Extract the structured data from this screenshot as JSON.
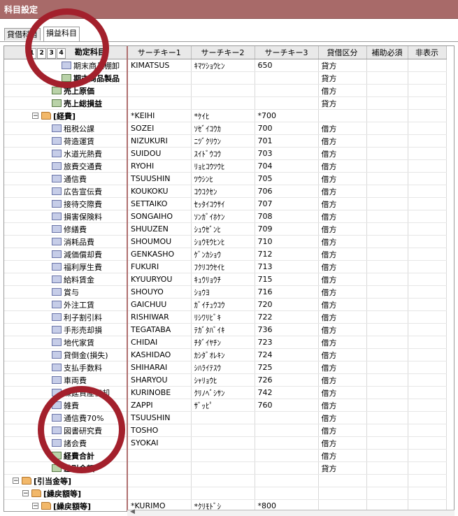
{
  "window": {
    "title": "科目設定"
  },
  "tabs": [
    {
      "label": "貸借科目",
      "active": false
    },
    {
      "label": "損益科目",
      "active": true
    }
  ],
  "grid": {
    "level_buttons": [
      "1",
      "2",
      "3",
      "4"
    ],
    "columns": [
      "勘定科目",
      "サーチキー1",
      "サーチキー2",
      "サーチキー3",
      "貸借区分",
      "補助必須",
      "非表示"
    ],
    "rows": [
      {
        "indent": 5,
        "icon": "doc",
        "name": "期末商品棚卸",
        "bold": false,
        "k1": "KIMATSUS",
        "k2": "ｷﾏﾂｼｮｳﾋﾝ",
        "k3": "650",
        "side": "貸方"
      },
      {
        "indent": 5,
        "icon": "sum",
        "name": "期末商品製品",
        "bold": true,
        "k1": "",
        "k2": "",
        "k3": "",
        "side": "貸方"
      },
      {
        "indent": 4,
        "icon": "sum",
        "name": "売上原価",
        "bold": true,
        "k1": "",
        "k2": "",
        "k3": "",
        "side": "借方"
      },
      {
        "indent": 4,
        "icon": "sum",
        "name": "売上総損益",
        "bold": true,
        "k1": "",
        "k2": "",
        "k3": "",
        "side": "貸方"
      },
      {
        "indent": 2,
        "icon": "folder",
        "expander": "minus",
        "name": "[経費]",
        "bold": true,
        "k1": "*KEIHI",
        "k2": "*ｹｲﾋ",
        "k3": "*700",
        "side": ""
      },
      {
        "indent": 4,
        "icon": "doc",
        "name": "租税公課",
        "k1": "SOZEI",
        "k2": "ｿｾﾞｲｺｳｶ",
        "k3": "700",
        "side": "借方"
      },
      {
        "indent": 4,
        "icon": "doc",
        "name": "荷造運賃",
        "k1": "NIZUKURI",
        "k2": "ﾆﾂﾞｸﾘｳﾝ",
        "k3": "701",
        "side": "借方"
      },
      {
        "indent": 4,
        "icon": "doc",
        "name": "水道光熱費",
        "k1": "SUIDOU",
        "k2": "ｽｲﾄﾞｳｺｳ",
        "k3": "703",
        "side": "借方"
      },
      {
        "indent": 4,
        "icon": "doc",
        "name": "旅費交通費",
        "k1": "RYOHI",
        "k2": "ﾘｮﾋｺｳﾂｳﾋ",
        "k3": "704",
        "side": "借方"
      },
      {
        "indent": 4,
        "icon": "doc",
        "name": "通信費",
        "k1": "TSUUSHIN",
        "k2": "ﾂｳｼﾝﾋ",
        "k3": "705",
        "side": "借方"
      },
      {
        "indent": 4,
        "icon": "doc",
        "name": "広告宣伝費",
        "k1": "KOUKOKU",
        "k2": "ｺｳｺｸｾﾝ",
        "k3": "706",
        "side": "借方"
      },
      {
        "indent": 4,
        "icon": "doc",
        "name": "接待交際費",
        "k1": "SETTAIKO",
        "k2": "ｾｯﾀｲｺｳｻｲ",
        "k3": "707",
        "side": "借方"
      },
      {
        "indent": 4,
        "icon": "doc",
        "name": "損害保険料",
        "k1": "SONGAIHO",
        "k2": "ｿﾝｶﾞｲﾎｹﾝ",
        "k3": "708",
        "side": "借方"
      },
      {
        "indent": 4,
        "icon": "doc",
        "name": "修繕費",
        "k1": "SHUUZEN",
        "k2": "ｼｭｳｾﾞﾝﾋ",
        "k3": "709",
        "side": "借方"
      },
      {
        "indent": 4,
        "icon": "doc",
        "name": "消耗品費",
        "k1": "SHOUMOU",
        "k2": "ｼｮｳﾓｳﾋﾝﾋ",
        "k3": "710",
        "side": "借方"
      },
      {
        "indent": 4,
        "icon": "doc",
        "name": "減価償却費",
        "k1": "GENKASHO",
        "k2": "ｹﾞﾝｶｼｮｳ",
        "k3": "712",
        "side": "借方"
      },
      {
        "indent": 4,
        "icon": "doc",
        "name": "福利厚生費",
        "k1": "FUKURI",
        "k2": "ﾌｸﾘｺｳｾｲﾋ",
        "k3": "713",
        "side": "借方"
      },
      {
        "indent": 4,
        "icon": "doc",
        "name": "給料賃金",
        "k1": "KYUURYOU",
        "k2": "ｷｭｳﾘｮｳﾁ",
        "k3": "715",
        "side": "借方"
      },
      {
        "indent": 4,
        "icon": "doc",
        "name": "賞与",
        "k1": "SHOUYO",
        "k2": "ｼｮｳﾖ",
        "k3": "716",
        "side": "借方"
      },
      {
        "indent": 4,
        "icon": "doc",
        "name": "外注工賃",
        "k1": "GAICHUU",
        "k2": "ｶﾞｲﾁｭｳｺｳ",
        "k3": "720",
        "side": "借方"
      },
      {
        "indent": 4,
        "icon": "doc",
        "name": "利子割引料",
        "k1": "RISHIWAR",
        "k2": "ﾘｼﾜﾘﾋﾞｷ",
        "k3": "722",
        "side": "借方"
      },
      {
        "indent": 4,
        "icon": "doc",
        "name": "手形売却損",
        "k1": "TEGATABA",
        "k2": "ﾃｶﾞﾀﾊﾞｲｷ",
        "k3": "736",
        "side": "借方"
      },
      {
        "indent": 4,
        "icon": "doc",
        "name": "地代家賃",
        "k1": "CHIDAI",
        "k2": "ﾁﾀﾞｲﾔﾁﾝ",
        "k3": "723",
        "side": "借方"
      },
      {
        "indent": 4,
        "icon": "doc",
        "name": "貸倒金(損失)",
        "k1": "KASHIDAO",
        "k2": "ｶｼﾀﾞｵﾚｷﾝ",
        "k3": "724",
        "side": "借方"
      },
      {
        "indent": 4,
        "icon": "doc",
        "name": "支払手数料",
        "k1": "SHIHARAI",
        "k2": "ｼﾊﾗｲﾃｽｳ",
        "k3": "725",
        "side": "借方"
      },
      {
        "indent": 4,
        "icon": "doc",
        "name": "車両費",
        "k1": "SHARYOU",
        "k2": "ｼｬﾘｮｳﾋ",
        "k3": "726",
        "side": "借方"
      },
      {
        "indent": 4,
        "icon": "doc",
        "name": "繰延資産償却",
        "k1": "KURINOBE",
        "k2": "ｸﾘﾉﾍﾞｼｻﾝ",
        "k3": "742",
        "side": "借方"
      },
      {
        "indent": 4,
        "icon": "doc",
        "name": "雑費",
        "k1": "ZAPPI",
        "k2": "ｻﾞｯﾋﾟ",
        "k3": "760",
        "side": "借方"
      },
      {
        "indent": 4,
        "icon": "doc",
        "name": "通信費70%",
        "k1": "TSUUSHIN",
        "k2": "",
        "k3": "",
        "side": "借方"
      },
      {
        "indent": 4,
        "icon": "doc",
        "name": "図書研究費",
        "k1": "TOSHO",
        "k2": "",
        "k3": "",
        "side": "借方"
      },
      {
        "indent": 4,
        "icon": "doc",
        "name": "諸会費",
        "k1": "SYOKAI",
        "k2": "",
        "k3": "",
        "side": "借方"
      },
      {
        "indent": 4,
        "icon": "sum",
        "name": "経費合計",
        "bold": true,
        "k1": "",
        "k2": "",
        "k3": "",
        "side": "借方"
      },
      {
        "indent": 4,
        "icon": "sum",
        "name": "差引金額",
        "bold": true,
        "k1": "",
        "k2": "",
        "k3": "",
        "side": "貸方"
      },
      {
        "indent": 0,
        "icon": "folder",
        "expander": "minus",
        "name": "[引当金等]",
        "bold": true,
        "k1": "",
        "k2": "",
        "k3": "",
        "side": ""
      },
      {
        "indent": 1,
        "icon": "folder",
        "expander": "minus",
        "name": "[繰戻額等]",
        "bold": true,
        "k1": "",
        "k2": "",
        "k3": "",
        "side": ""
      },
      {
        "indent": 2,
        "icon": "folder",
        "expander": "minus",
        "name": "[繰戻額等]",
        "bold": true,
        "k1": "*KURIMO",
        "k2": "*ｸﾘﾓﾄﾞｼ",
        "k3": "*800",
        "side": ""
      }
    ]
  }
}
